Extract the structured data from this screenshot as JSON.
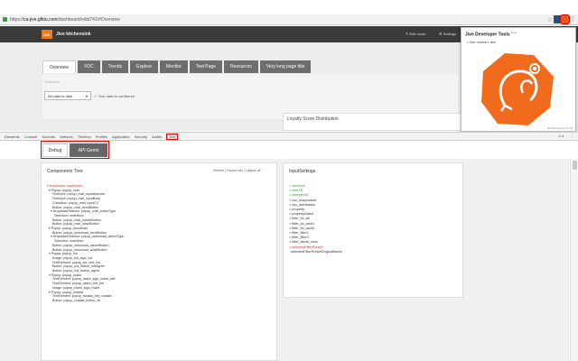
{
  "browser": {
    "url_prefix": "https://",
    "url_domain": "ca-jive.gfktu.com",
    "url_path": "/dashboard/edit/741/#Overview"
  },
  "app": {
    "logo_text": "GfK",
    "title": "Jive kitchensink",
    "edit_mode": "Edit mode",
    "settings": "Settings"
  },
  "tabs": [
    {
      "label": "Overview"
    },
    {
      "label": "VOC"
    },
    {
      "label": "Trends"
    },
    {
      "label": "Explore"
    },
    {
      "label": "Monitor"
    },
    {
      "label": "Test Page"
    },
    {
      "label": "Resources"
    },
    {
      "label": "Very long page title"
    }
  ],
  "page": {
    "overview_label": "Overview",
    "plants_select": "All plats to date",
    "filter_note": "Your data is not filtered",
    "loyalty_title": "Loyalty Score Distribution"
  },
  "popup": {
    "title": "Jive Developer Tools",
    "beta": "Beta",
    "version": "Jive version: dev",
    "footer": "Mockdevelopment for GfK"
  },
  "devtools": {
    "tabs": [
      "Elements",
      "Console",
      "Sources",
      "Network",
      "Timeline",
      "Profiles",
      "Application",
      "Security",
      "Audits",
      "Jive"
    ],
    "status": "2 4",
    "subtabs": {
      "debug": "Debug",
      "api": "API Gems"
    }
  },
  "components": {
    "title": "Components Tree",
    "links": "Refresh | Expand all | Collapse all",
    "items": [
      "▾ Dashboard: dashboard",
      "  ▾ Popup: popup_mail",
      "      TextInput: popup_mail_inputAddress",
      "      TextInput: popup_mail_inputBody",
      "      Checkbox: popup_mail_inputCC",
      "      Button: popup_mail_sendButton",
      "    ▾ DropdownSelector: popup_mail_selectType",
      "        Selection: undefined",
      "      Button: popup_mail_cancelButton",
      "      Button: popup_mail_closeButton",
      "  ▾ Popup: popup_download",
      "      Button: popup_download_sendButton",
      "    ▾ DropdownSelector: popup_download_selectType",
      "        Selection: undefined",
      "      Button: popup_download_cancelButton",
      "      Button: popup_download_closeButton",
      "  ▾ Popup: popup_tos",
      "      Image: popup_tos_logo_tos",
      "      TextElement: popup_tos_text_tos",
      "      Button: popup_tos_button_notAgree",
      "      Button: popup_tos_button_agree",
      "  ▾ Popup: popup_maint",
      "      TextElement: popup_maint_logo_maint_title",
      "      TextElement: popup_maint_text_tos",
      "      Image: popup_maint_logo_maint",
      "  ▾ Popup: popup_nodata",
      "      TextElement: popup_nodata_text_nodata",
      "      Button: popup_nodata_button_ok"
    ]
  },
  "inputs": {
    "title": "InputSettings",
    "items": [
      {
        "text": "> datefrom",
        "color": "green"
      },
      {
        "text": "> dateTill",
        "color": "green"
      },
      {
        "text": "> dateperiod",
        "color": "green"
      },
      {
        "text": "> voc_respondent",
        "color": "none"
      },
      {
        "text": "> voc_alertstatus",
        "color": "none"
      },
      {
        "text": "> property",
        "color": "none"
      },
      {
        "text": "> propertyName",
        "color": "none"
      },
      {
        "text": "> filter_fct_all",
        "color": "none"
      },
      {
        "text": "> filter_fct_arch1",
        "color": "none"
      },
      {
        "text": "> filter_fct_arch2",
        "color": "none"
      },
      {
        "text": "> filter_filter1",
        "color": "none"
      },
      {
        "text": "> filter_filter2",
        "color": "none"
      },
      {
        "text": "> filter_alerts_none",
        "color": "none"
      },
      {
        "text": "> selectedFilterPreset",
        "color": "red"
      },
      {
        "text": "  selectedFilterPresetOriginalName",
        "color": "none"
      }
    ]
  },
  "colors": {
    "accent": "#f07a1e",
    "header": "#3b3b3b",
    "tab_bg": "#6d6d6d",
    "highlight": "#ee0000"
  }
}
